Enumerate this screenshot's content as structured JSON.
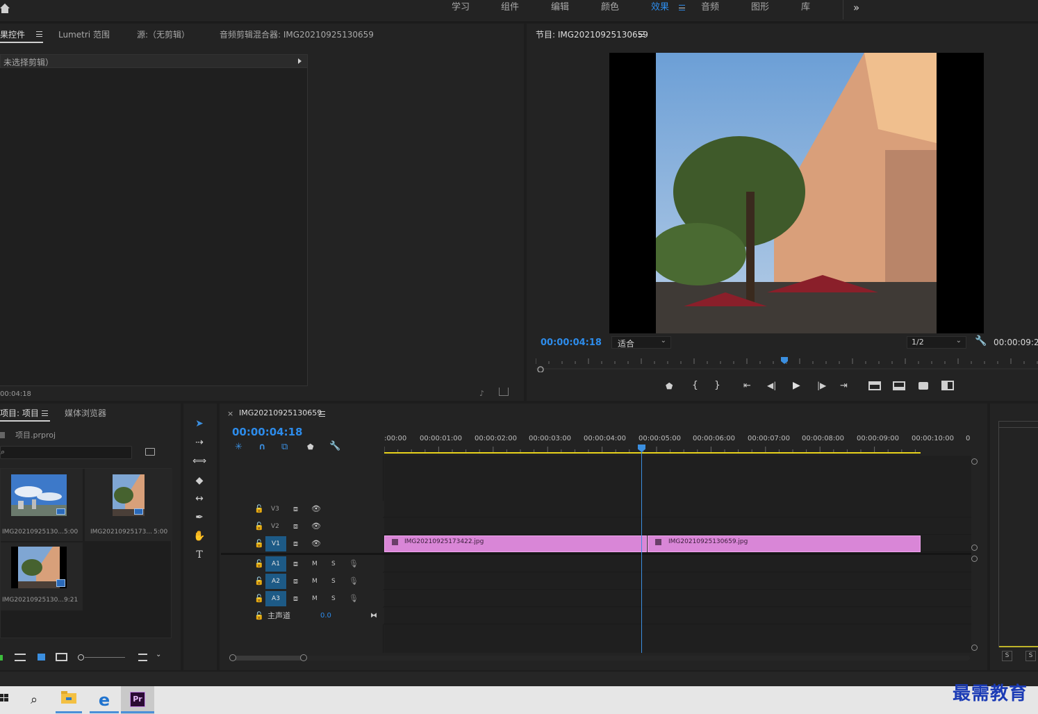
{
  "workspace_tabs": [
    "学习",
    "组件",
    "编辑",
    "颜色",
    "效果",
    "音频",
    "图形",
    "库"
  ],
  "workspace_active": "效果",
  "more_icon": "»",
  "effects_panel": {
    "tabs": [
      "效果控件",
      "Lumetri 范围",
      "源:（无剪辑）",
      "音频剪辑混合器: IMG20210925130659"
    ],
    "no_clip": "未选择剪辑）",
    "timecode": "00:04:18"
  },
  "program_monitor": {
    "title": "节目: IMG20210925130659",
    "timecode": "00:00:04:18",
    "fit": "适合",
    "resolution": "1/2",
    "duration": "00:00:09:2"
  },
  "project_panel": {
    "tabs": [
      "项目: 项目",
      "媒体浏览器"
    ],
    "project_file": "项目.prproj",
    "search_placeholder": "",
    "items": [
      {
        "name": "IMG20210925130...",
        "dur": "5:00"
      },
      {
        "name": "IMG20210925173...",
        "dur": "5:00"
      },
      {
        "name": "IMG20210925130...",
        "dur": "9:21"
      }
    ]
  },
  "timeline": {
    "close": "×",
    "title": "IMG20210925130659",
    "timecode": "00:00:04:18",
    "ruler": [
      ":00:00",
      "00:00:01:00",
      "00:00:02:00",
      "00:00:03:00",
      "00:00:04:00",
      "00:00:05:00",
      "00:00:06:00",
      "00:00:07:00",
      "00:00:08:00",
      "00:00:09:00",
      "00:00:10:00",
      "0"
    ],
    "video_tracks": [
      "V3",
      "V2",
      "V1"
    ],
    "audio_tracks": [
      "A1",
      "A2",
      "A3"
    ],
    "audio_mute": "M",
    "audio_solo": "S",
    "master_label": "主声道",
    "master_value": "0.0",
    "clips": [
      "IMG20210925173422.jpg",
      "IMG20210925130659.jpg"
    ]
  },
  "meter": {
    "s1": "S",
    "s2": "S"
  },
  "watermark": "最需教育",
  "taskbar": {
    "app_label": "Pr"
  }
}
